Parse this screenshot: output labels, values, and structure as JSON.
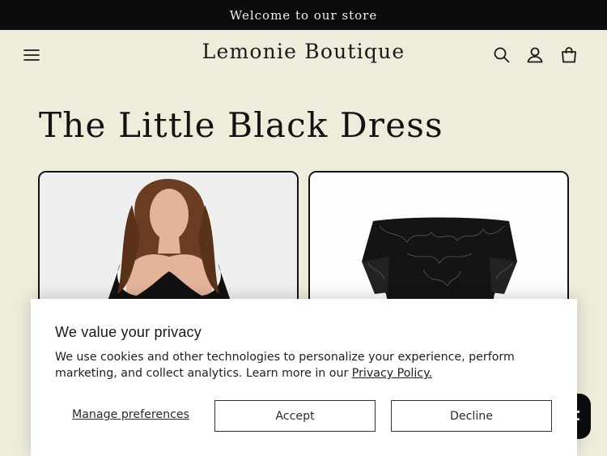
{
  "announcement": {
    "text": "Welcome to our store"
  },
  "header": {
    "brand": "Lemonie Boutique",
    "icons": [
      "menu-icon",
      "search-icon",
      "account-icon",
      "cart-icon"
    ]
  },
  "main": {
    "title": "The Little Black Dress"
  },
  "privacy_banner": {
    "title": "We value your privacy",
    "body": "We use cookies and other technologies to personalize your experience, perform marketing, and collect analytics. Learn more in our ",
    "policy_link": "Privacy Policy.",
    "manage_label": "Manage preferences",
    "accept_label": "Accept",
    "decline_label": "Decline"
  },
  "colors": {
    "page_bg": "#f0ecdc",
    "announcement_bg": "#0c0c0c",
    "text": "#121212",
    "banner_bg": "#ffffff"
  }
}
